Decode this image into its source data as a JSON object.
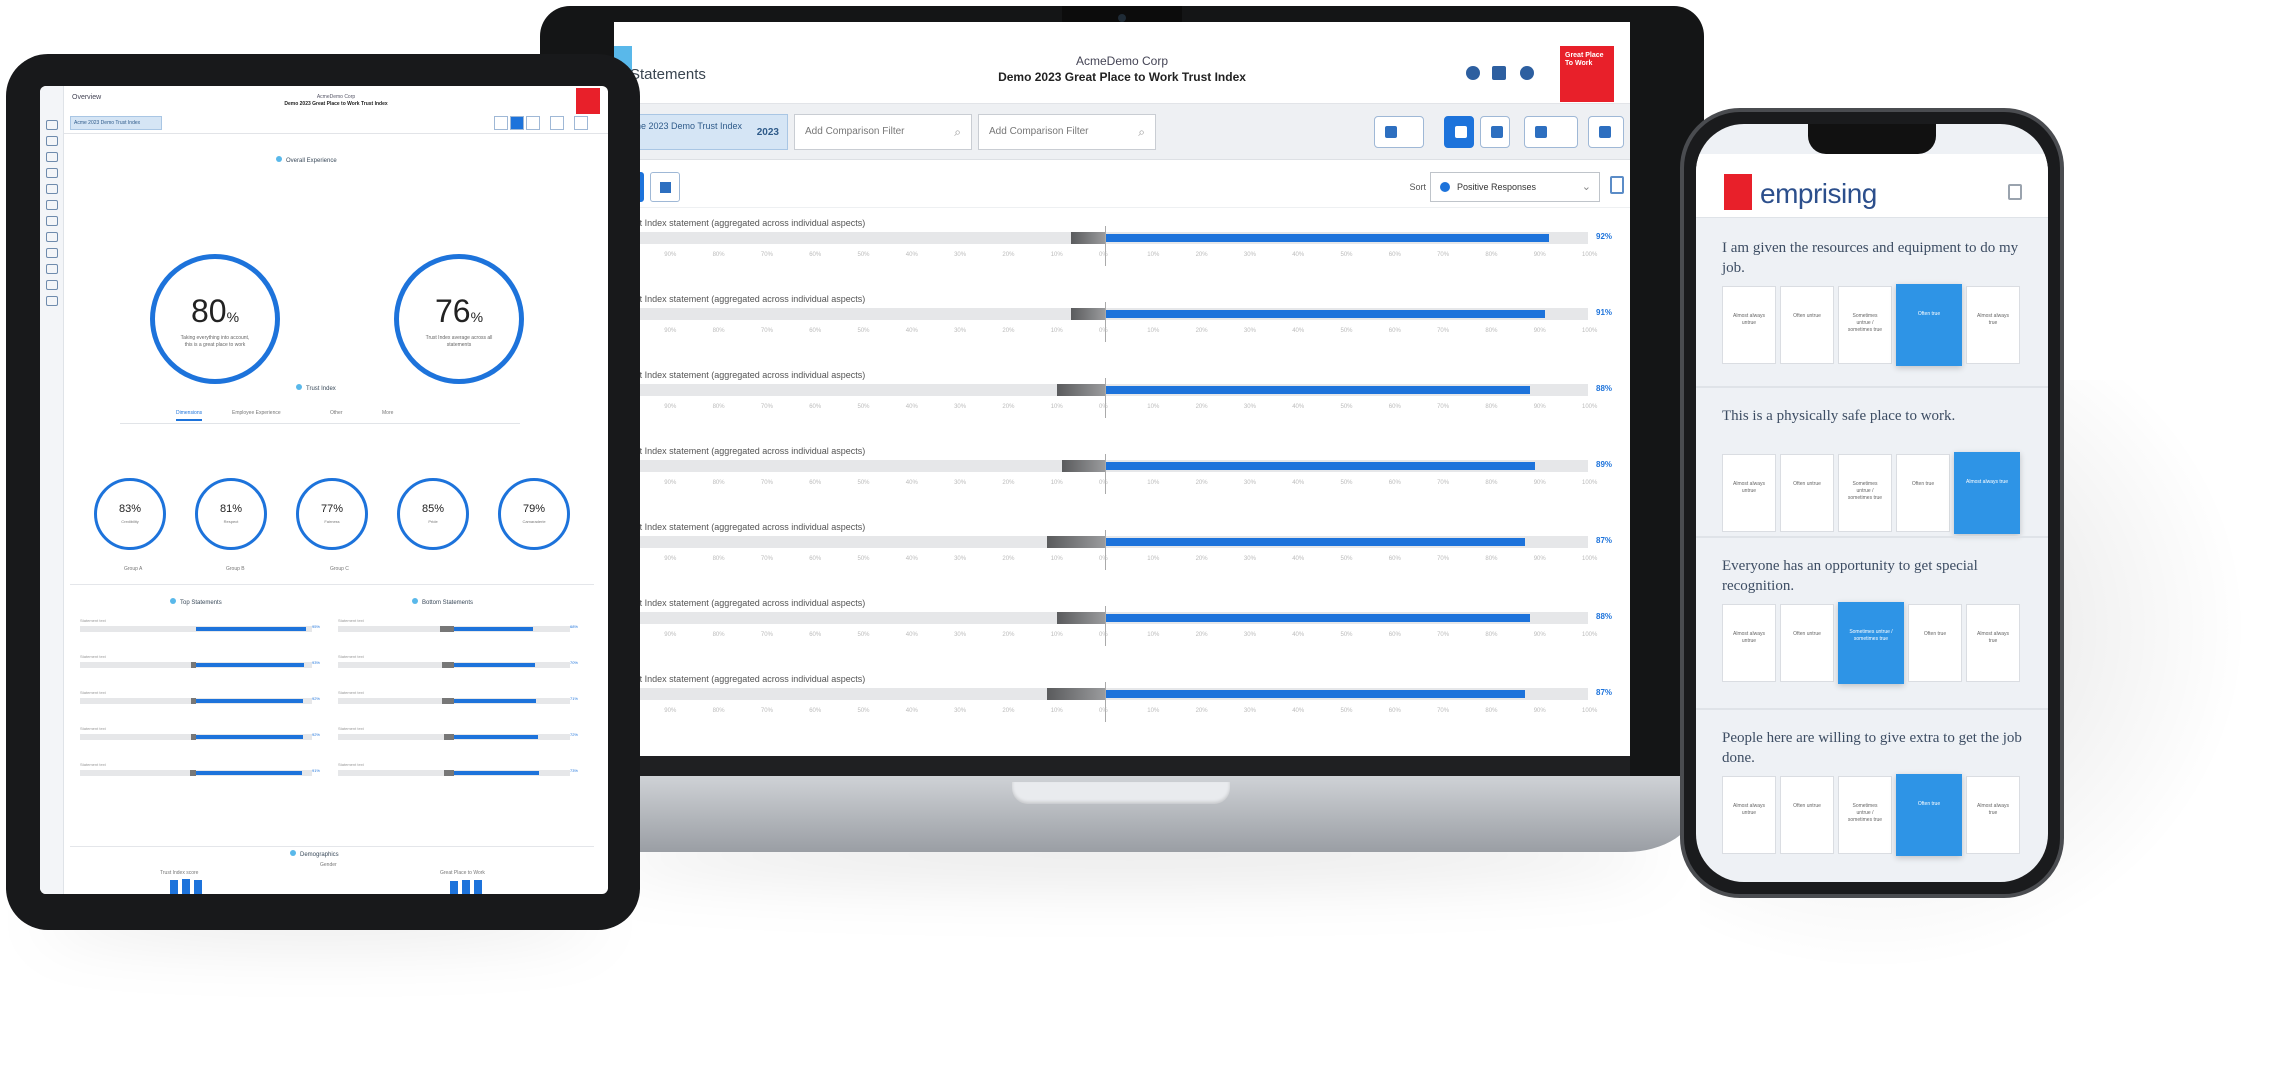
{
  "laptop": {
    "app_name": "Statements",
    "company": "AcmeDemo Corp",
    "survey": "Demo 2023 Great Place to Work Trust Index",
    "brand_badge": "Great Place To Work",
    "filter_chip": "Acme 2023 Demo Trust Index",
    "filter_chip_count": "2023",
    "add_comparison_1": "Add Comparison Filter",
    "add_comparison_2": "Add Comparison Filter",
    "sort_label": "Sort",
    "sort_value": "Positive Responses",
    "row_label": "Trust Index statement (aggregated across individual aspects)",
    "axis_ticks": [
      "100%",
      "90%",
      "80%",
      "70%",
      "60%",
      "50%",
      "40%",
      "30%",
      "20%",
      "10%",
      "0%",
      "10%",
      "20%",
      "30%",
      "40%",
      "50%",
      "60%",
      "70%",
      "80%",
      "90%",
      "100%"
    ],
    "rows": [
      {
        "label": "Trust Index statement (aggregated across individual aspects)",
        "negative": 7,
        "positive": 92,
        "pct": "92%"
      },
      {
        "label": "Trust Index statement (aggregated across individual aspects)",
        "negative": 7,
        "positive": 91,
        "pct": "91%"
      },
      {
        "label": "Trust Index statement (aggregated across individual aspects)",
        "negative": 10,
        "positive": 88,
        "pct": "88%"
      },
      {
        "label": "Trust Index statement (aggregated across individual aspects)",
        "negative": 9,
        "positive": 89,
        "pct": "89%"
      },
      {
        "label": "Trust Index statement (aggregated across individual aspects)",
        "negative": 12,
        "positive": 87,
        "pct": "87%"
      },
      {
        "label": "Trust Index statement (aggregated across individual aspects)",
        "negative": 10,
        "positive": 88,
        "pct": "88%"
      },
      {
        "label": "Trust Index statement (aggregated across individual aspects)",
        "negative": 12,
        "positive": 87,
        "pct": "87%"
      }
    ]
  },
  "tablet": {
    "crumb": "Overview",
    "title1": "AcmeDemo Corp",
    "title2": "Demo 2023 Great Place to Work Trust Index",
    "filter_chip": "Acme 2023 Demo Trust Index",
    "section_overall": "Overall Experience",
    "big_rings": [
      {
        "value": "80",
        "unit": "%",
        "caption": "Taking everything into account, this is a great place to work"
      },
      {
        "value": "76",
        "unit": "%",
        "caption": "Trust Index average across all statements"
      }
    ],
    "section_dimensions": "Trust Index",
    "tabs": [
      "Dimensions",
      "Employee Experience",
      "Other",
      "More"
    ],
    "small_rings": [
      {
        "value": "83%",
        "caption": "Credibility"
      },
      {
        "value": "81%",
        "caption": "Respect"
      },
      {
        "value": "77%",
        "caption": "Fairness"
      },
      {
        "value": "85%",
        "caption": "Pride"
      },
      {
        "value": "79%",
        "caption": "Camaraderie"
      }
    ],
    "ring_labels": [
      "Group A",
      "Group B",
      "Group C"
    ],
    "section_top": "Top Statements",
    "section_bottom": "Bottom Statements",
    "bar_rows_left": [
      {
        "pct": "95%",
        "neg": 0,
        "pos": 95
      },
      {
        "pct": "93%",
        "neg": 4,
        "pos": 93
      },
      {
        "pct": "92%",
        "neg": 4,
        "pos": 92
      },
      {
        "pct": "92%",
        "neg": 4,
        "pos": 92
      },
      {
        "pct": "91%",
        "neg": 5,
        "pos": 91
      }
    ],
    "bar_rows_right": [
      {
        "pct": "68%",
        "neg": 12,
        "pos": 68
      },
      {
        "pct": "70%",
        "neg": 10,
        "pos": 70
      },
      {
        "pct": "71%",
        "neg": 10,
        "pos": 71
      },
      {
        "pct": "72%",
        "neg": 9,
        "pos": 72
      },
      {
        "pct": "73%",
        "neg": 9,
        "pos": 73
      }
    ],
    "bar_row_label": "Statement text",
    "section_demographics": "Demographics",
    "demo_sub": "Gender",
    "demo_left_title": "Trust Index score",
    "demo_right_title": "Great Place to Work",
    "demo_left_values": [
      78,
      82,
      80
    ],
    "demo_right_values": [
      74,
      79,
      77
    ]
  },
  "phone": {
    "logo": "emprising",
    "questions": [
      {
        "text": "I am given the resources and equipment to do my job.",
        "selected": 3
      },
      {
        "text": "This is a physically safe place to work.",
        "selected": 4
      },
      {
        "text": "Everyone has an opportunity to get special recognition.",
        "selected": 2
      },
      {
        "text": "People here are willing to give extra to get the job done.",
        "selected": 3
      }
    ],
    "options": [
      "Almost always untrue",
      "Often untrue",
      "Sometimes untrue / sometimes true",
      "Often true",
      "Almost always true"
    ]
  },
  "colors": {
    "accent": "#1d73db",
    "brand_red": "#e8202a",
    "logo_blue": "#2c4f8c"
  }
}
